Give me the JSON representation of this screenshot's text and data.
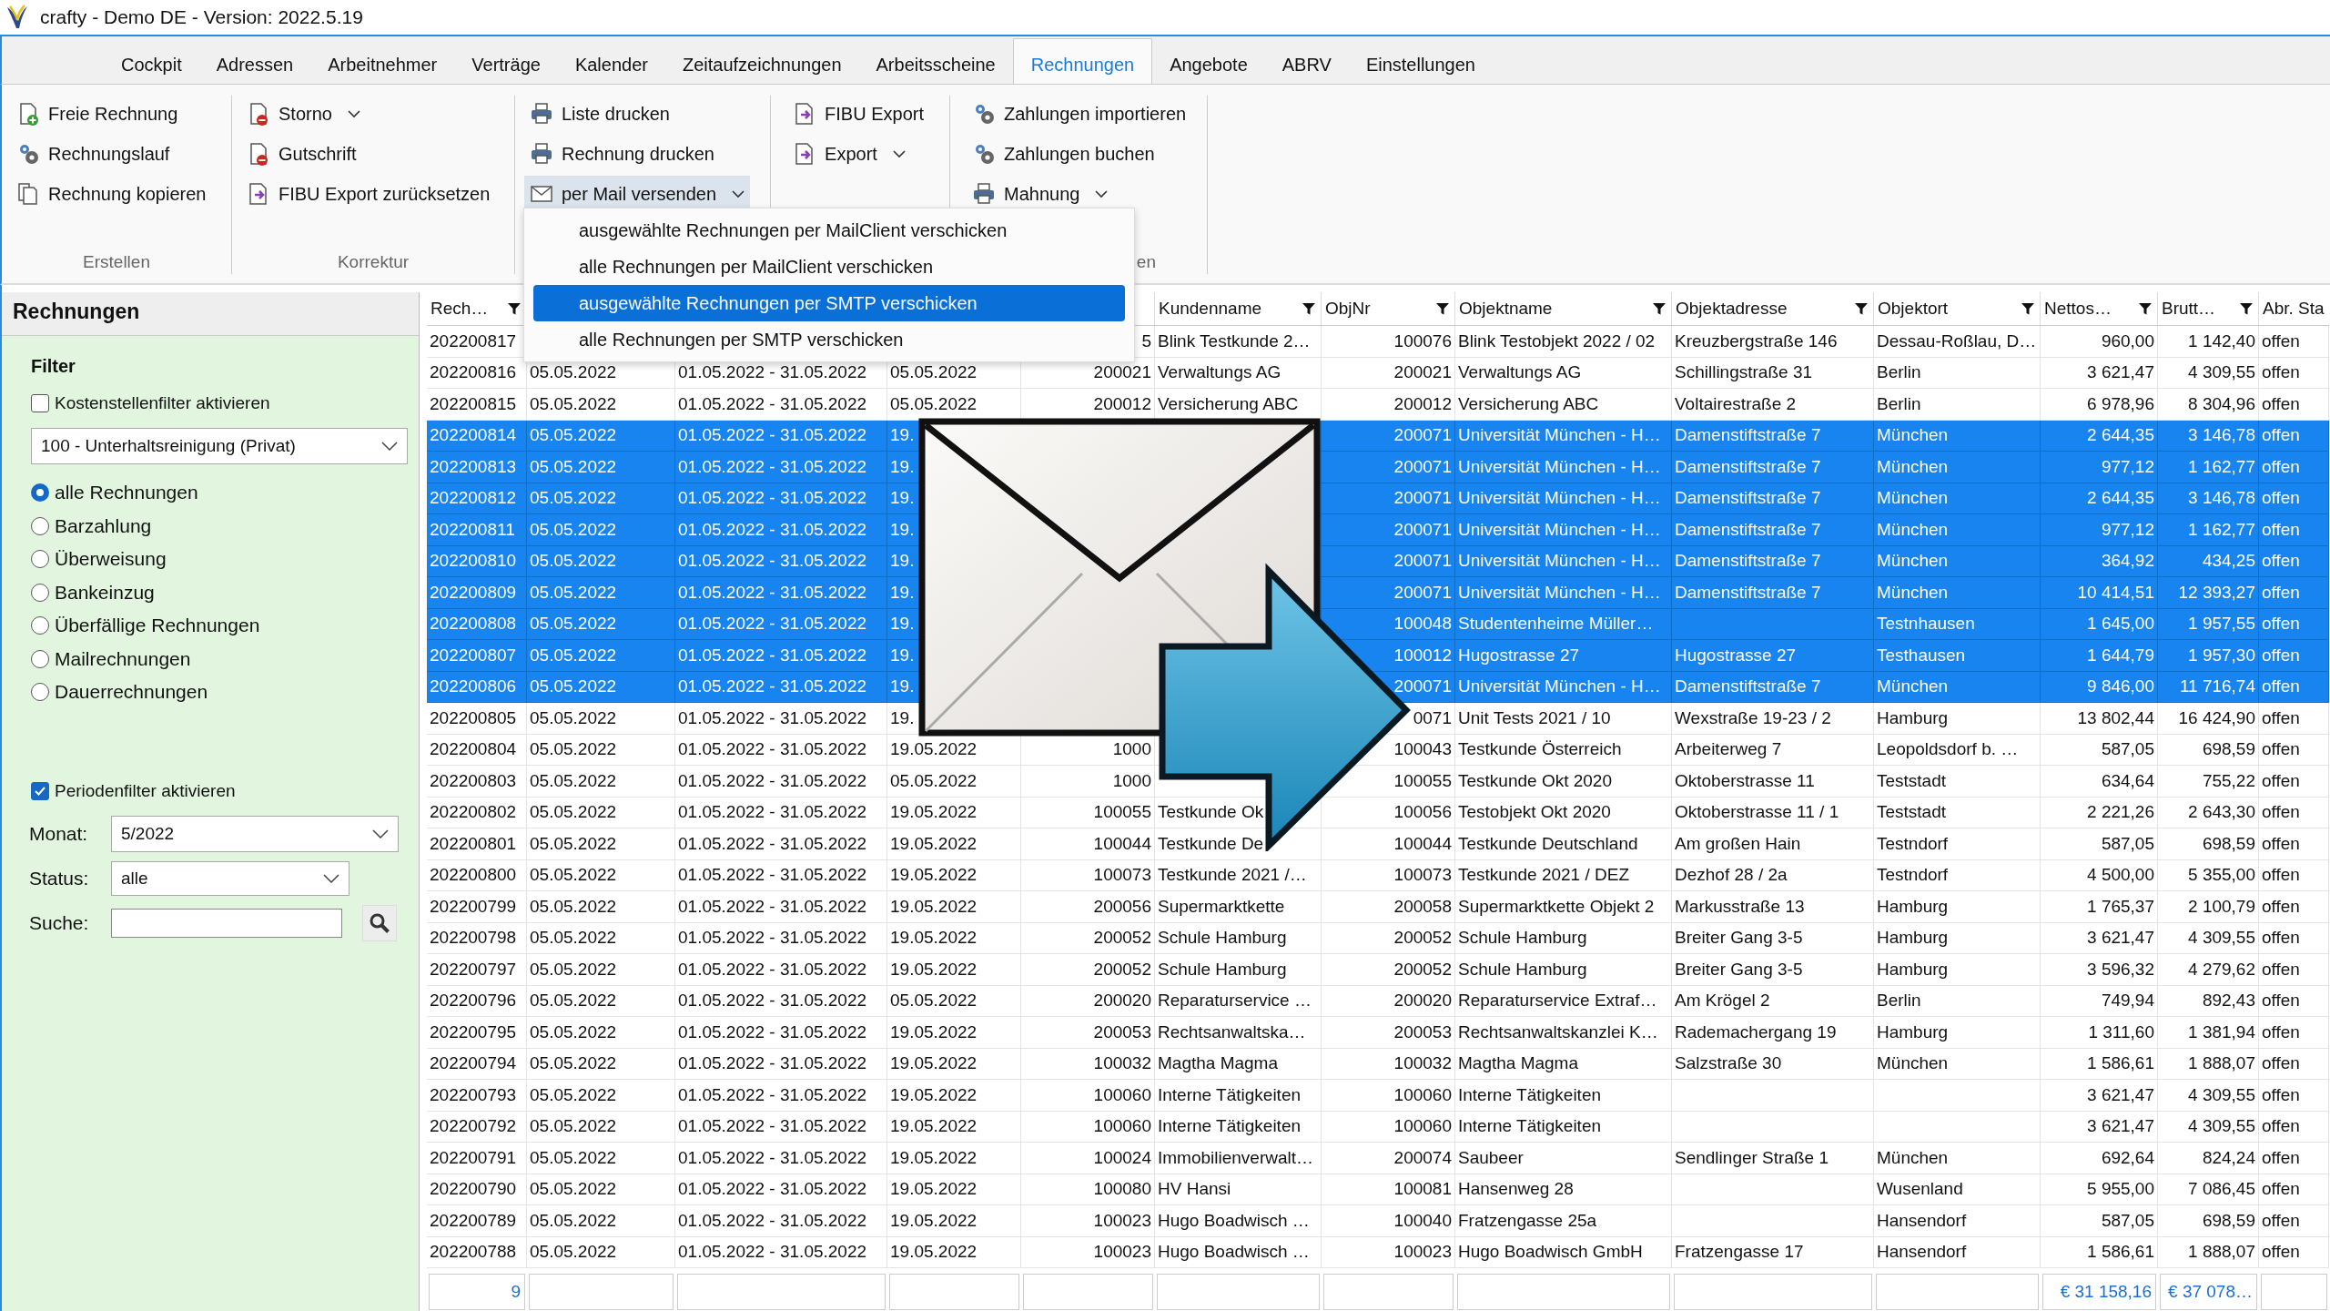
{
  "window": {
    "title": "crafty - Demo DE - Version: 2022.5.19"
  },
  "tabs": [
    {
      "label": "Cockpit",
      "selected": false
    },
    {
      "label": "Adressen",
      "selected": false
    },
    {
      "label": "Arbeitnehmer",
      "selected": false
    },
    {
      "label": "Verträge",
      "selected": false
    },
    {
      "label": "Kalender",
      "selected": false
    },
    {
      "label": "Zeitaufzeichnungen",
      "selected": false
    },
    {
      "label": "Arbeitsscheine",
      "selected": false
    },
    {
      "label": "Rechnungen",
      "selected": true
    },
    {
      "label": "Angebote",
      "selected": false
    },
    {
      "label": "ABRV",
      "selected": false
    },
    {
      "label": "Einstellungen",
      "selected": false
    }
  ],
  "ribbon": {
    "groups": [
      {
        "label": "Erstellen",
        "columns": [
          [
            {
              "label": "Freie Rechnung",
              "kind": "new",
              "dropdown": false,
              "pressed": false
            },
            {
              "label": "Rechnungslauf",
              "kind": "gears",
              "dropdown": false,
              "pressed": false
            },
            {
              "label": "Rechnung kopieren",
              "kind": "copy",
              "dropdown": false,
              "pressed": false
            }
          ]
        ]
      },
      {
        "label": "Korrektur",
        "columns": [
          [
            {
              "label": "Storno",
              "kind": "cancel",
              "dropdown": true,
              "pressed": false
            },
            {
              "label": "Gutschrift",
              "kind": "cancel",
              "dropdown": false,
              "pressed": false
            },
            {
              "label": "FIBU Export zurücksetzen",
              "kind": "export",
              "dropdown": false,
              "pressed": false
            }
          ]
        ]
      },
      {
        "label": "en",
        "columns": [
          [
            {
              "label": "Liste drucken",
              "kind": "print",
              "dropdown": false,
              "pressed": false
            },
            {
              "label": "Rechnung drucken",
              "kind": "print",
              "dropdown": false,
              "pressed": false
            },
            {
              "label": "per Mail versenden",
              "kind": "mail",
              "dropdown": true,
              "pressed": true
            }
          ],
          [
            {
              "label": "FIBU Export",
              "kind": "export",
              "dropdown": false,
              "pressed": false
            },
            {
              "label": "Export",
              "kind": "export",
              "dropdown": true,
              "pressed": false
            }
          ],
          [
            {
              "label": "Zahlungen importieren",
              "kind": "gears",
              "dropdown": false,
              "pressed": false
            },
            {
              "label": "Zahlungen buchen",
              "kind": "gears",
              "dropdown": false,
              "pressed": false
            },
            {
              "label": "Mahnung",
              "kind": "print",
              "dropdown": true,
              "pressed": false
            }
          ]
        ]
      }
    ]
  },
  "mail_menu": [
    {
      "label": "ausgewählte Rechnungen per MailClient verschicken",
      "selected": false
    },
    {
      "label": "alle Rechnungen per MailClient verschicken",
      "selected": false
    },
    {
      "label": "ausgewählte Rechnungen per SMTP verschicken",
      "selected": true
    },
    {
      "label": "alle Rechnungen per SMTP verschicken",
      "selected": false
    }
  ],
  "sidebar": {
    "title": "Rechnungen",
    "filter_heading": "Filter",
    "cost_filter": {
      "label": "Kostenstellenfilter aktivieren",
      "checked": false
    },
    "cost_center": {
      "value": "100 - Unterhaltsreinigung (Privat)"
    },
    "invoice_types": [
      {
        "label": "alle Rechnungen",
        "selected": true
      },
      {
        "label": "Barzahlung",
        "selected": false
      },
      {
        "label": "Überweisung",
        "selected": false
      },
      {
        "label": "Bankeinzug",
        "selected": false
      },
      {
        "label": "Überfällige Rechnungen",
        "selected": false
      },
      {
        "label": "Mailrechnungen",
        "selected": false
      },
      {
        "label": "Dauerrechnungen",
        "selected": false
      }
    ],
    "period_filter": {
      "label": "Periodenfilter aktivieren",
      "checked": true
    },
    "fields": [
      {
        "label": "Monat:",
        "value": "5/2022",
        "kind": "dropdown"
      },
      {
        "label": "Status:",
        "value": "alle",
        "kind": "dropdown"
      },
      {
        "label": "Suche:",
        "kind": "search"
      }
    ]
  },
  "table": {
    "columns": [
      "Rech…",
      null,
      null,
      null,
      null,
      "Kundenname",
      "ObjNr",
      "Objektname",
      "Objektadresse",
      "Objektort",
      "Nettos…",
      "Brutt…",
      "Abr. Sta"
    ],
    "rows": [
      {
        "selected": false,
        "cells": [
          "202200817",
          null,
          null,
          null,
          "5",
          "Blink Testkunde 2…",
          "100076",
          "Blink Testobjekt 2022 / 02",
          "Kreuzbergstraße 146",
          "Dessau-Roßlau, D…",
          "960,00",
          "1 142,40",
          "offen"
        ]
      },
      {
        "selected": false,
        "cells": [
          "202200816",
          "05.05.2022",
          "01.05.2022 - 31.05.2022",
          "05.05.2022",
          "200021",
          "Verwaltungs AG",
          "200021",
          "Verwaltungs AG",
          "Schillingstraße 31",
          "Berlin",
          "3 621,47",
          "4 309,55",
          "offen"
        ]
      },
      {
        "selected": false,
        "cells": [
          "202200815",
          "05.05.2022",
          "01.05.2022 - 31.05.2022",
          "05.05.2022",
          "200012",
          "Versicherung ABC",
          "200012",
          "Versicherung ABC",
          "Voltairestraße 2",
          "Berlin",
          "6 978,96",
          "8 304,96",
          "offen"
        ]
      },
      {
        "selected": true,
        "cells": [
          "202200814",
          "05.05.2022",
          "01.05.2022 - 31.05.2022",
          "19.",
          null,
          null,
          "200071",
          "Universität München - H…",
          "Damenstiftstraße 7",
          "München",
          "2 644,35",
          "3 146,78",
          "offen"
        ]
      },
      {
        "selected": true,
        "cells": [
          "202200813",
          "05.05.2022",
          "01.05.2022 - 31.05.2022",
          "19.",
          null,
          null,
          "200071",
          "Universität München - H…",
          "Damenstiftstraße 7",
          "München",
          "977,12",
          "1 162,77",
          "offen"
        ]
      },
      {
        "selected": true,
        "cells": [
          "202200812",
          "05.05.2022",
          "01.05.2022 - 31.05.2022",
          "19.",
          null,
          null,
          "200071",
          "Universität München - H…",
          "Damenstiftstraße 7",
          "München",
          "2 644,35",
          "3 146,78",
          "offen"
        ]
      },
      {
        "selected": true,
        "cells": [
          "202200811",
          "05.05.2022",
          "01.05.2022 - 31.05.2022",
          "19.",
          null,
          null,
          "200071",
          "Universität München - H…",
          "Damenstiftstraße 7",
          "München",
          "977,12",
          "1 162,77",
          "offen"
        ]
      },
      {
        "selected": true,
        "cells": [
          "202200810",
          "05.05.2022",
          "01.05.2022 - 31.05.2022",
          "19.",
          null,
          null,
          "200071",
          "Universität München - H…",
          "Damenstiftstraße 7",
          "München",
          "364,92",
          "434,25",
          "offen"
        ]
      },
      {
        "selected": true,
        "cells": [
          "202200809",
          "05.05.2022",
          "01.05.2022 - 31.05.2022",
          "19.",
          null,
          null,
          "200071",
          "Universität München - H…",
          "Damenstiftstraße 7",
          "München",
          "10 414,51",
          "12 393,27",
          "offen"
        ]
      },
      {
        "selected": true,
        "cells": [
          "202200808",
          "05.05.2022",
          "01.05.2022 - 31.05.2022",
          "19.",
          null,
          null,
          "100048",
          "Studentenheime Müller…",
          null,
          "Testnhausen",
          "1 645,00",
          "1 957,55",
          "offen"
        ]
      },
      {
        "selected": true,
        "cells": [
          "202200807",
          "05.05.2022",
          "01.05.2022 - 31.05.2022",
          "19.",
          null,
          null,
          "100012",
          "Hugostrasse 27",
          "Hugostrasse 27",
          "Testhausen",
          "1 644,79",
          "1 957,30",
          "offen"
        ]
      },
      {
        "selected": true,
        "cells": [
          "202200806",
          "05.05.2022",
          "01.05.2022 - 31.05.2022",
          "19.",
          null,
          null,
          "200071",
          "Universität München - H…",
          "Damenstiftstraße 7",
          "München",
          "9 846,00",
          "11 716,74",
          "offen"
        ]
      },
      {
        "selected": false,
        "cells": [
          "202200805",
          "05.05.2022",
          "01.05.2022 - 31.05.2022",
          "19.",
          null,
          null,
          "0071",
          "Unit Tests 2021 / 10",
          "Wexstraße 19-23 / 2",
          "Hamburg",
          "13 802,44",
          "16 424,90",
          "offen"
        ]
      },
      {
        "selected": false,
        "cells": [
          "202200804",
          "05.05.2022",
          "01.05.2022 - 31.05.2022",
          "19.05.2022",
          "1000",
          null,
          "100043",
          "Testkunde Österreich",
          "Arbeiterweg 7",
          "Leopoldsdorf b. …",
          "587,05",
          "698,59",
          "offen"
        ]
      },
      {
        "selected": false,
        "cells": [
          "202200803",
          "05.05.2022",
          "01.05.2022 - 31.05.2022",
          "05.05.2022",
          "1000",
          null,
          "100055",
          "Testkunde Okt 2020",
          "Oktoberstrasse 11",
          "Teststadt",
          "634,64",
          "755,22",
          "offen"
        ]
      },
      {
        "selected": false,
        "cells": [
          "202200802",
          "05.05.2022",
          "01.05.2022 - 31.05.2022",
          "19.05.2022",
          "100055",
          "Testkunde Ok",
          "100056",
          "Testobjekt Okt 2020",
          "Oktoberstrasse 11 / 1",
          "Teststadt",
          "2 221,26",
          "2 643,30",
          "offen"
        ]
      },
      {
        "selected": false,
        "cells": [
          "202200801",
          "05.05.2022",
          "01.05.2022 - 31.05.2022",
          "19.05.2022",
          "100044",
          "Testkunde De",
          "100044",
          "Testkunde Deutschland",
          "Am großen Hain",
          "Testndorf",
          "587,05",
          "698,59",
          "offen"
        ]
      },
      {
        "selected": false,
        "cells": [
          "202200800",
          "05.05.2022",
          "01.05.2022 - 31.05.2022",
          "19.05.2022",
          "100073",
          "Testkunde 2021 /…",
          "100073",
          "Testkunde 2021 / DEZ",
          "Dezhof 28 / 2a",
          "Testndorf",
          "4 500,00",
          "5 355,00",
          "offen"
        ]
      },
      {
        "selected": false,
        "cells": [
          "202200799",
          "05.05.2022",
          "01.05.2022 - 31.05.2022",
          "19.05.2022",
          "200056",
          "Supermarktkette",
          "200058",
          "Supermarktkette Objekt 2",
          "Markusstraße 13",
          "Hamburg",
          "1 765,37",
          "2 100,79",
          "offen"
        ]
      },
      {
        "selected": false,
        "cells": [
          "202200798",
          "05.05.2022",
          "01.05.2022 - 31.05.2022",
          "19.05.2022",
          "200052",
          "Schule Hamburg",
          "200052",
          "Schule Hamburg",
          "Breiter Gang 3-5",
          "Hamburg",
          "3 621,47",
          "4 309,55",
          "offen"
        ]
      },
      {
        "selected": false,
        "cells": [
          "202200797",
          "05.05.2022",
          "01.05.2022 - 31.05.2022",
          "19.05.2022",
          "200052",
          "Schule Hamburg",
          "200052",
          "Schule Hamburg",
          "Breiter Gang 3-5",
          "Hamburg",
          "3 596,32",
          "4 279,62",
          "offen"
        ]
      },
      {
        "selected": false,
        "cells": [
          "202200796",
          "05.05.2022",
          "01.05.2022 - 31.05.2022",
          "05.05.2022",
          "200020",
          "Reparaturservice …",
          "200020",
          "Reparaturservice Extraf…",
          "Am Krögel 2",
          "Berlin",
          "749,94",
          "892,43",
          "offen"
        ]
      },
      {
        "selected": false,
        "cells": [
          "202200795",
          "05.05.2022",
          "01.05.2022 - 31.05.2022",
          "19.05.2022",
          "200053",
          "Rechtsanwaltska…",
          "200053",
          "Rechtsanwaltskanzlei K…",
          "Rademachergang 19",
          "Hamburg",
          "1 311,60",
          "1 381,94",
          "offen"
        ]
      },
      {
        "selected": false,
        "cells": [
          "202200794",
          "05.05.2022",
          "01.05.2022 - 31.05.2022",
          "19.05.2022",
          "100032",
          "Magtha Magma",
          "100032",
          "Magtha Magma",
          "Salzstraße 30",
          "München",
          "1 586,61",
          "1 888,07",
          "offen"
        ]
      },
      {
        "selected": false,
        "cells": [
          "202200793",
          "05.05.2022",
          "01.05.2022 - 31.05.2022",
          "19.05.2022",
          "100060",
          "Interne Tätigkeiten",
          "100060",
          "Interne Tätigkeiten",
          null,
          null,
          "3 621,47",
          "4 309,55",
          "offen"
        ]
      },
      {
        "selected": false,
        "cells": [
          "202200792",
          "05.05.2022",
          "01.05.2022 - 31.05.2022",
          "19.05.2022",
          "100060",
          "Interne Tätigkeiten",
          "100060",
          "Interne Tätigkeiten",
          null,
          null,
          "3 621,47",
          "4 309,55",
          "offen"
        ]
      },
      {
        "selected": false,
        "cells": [
          "202200791",
          "05.05.2022",
          "01.05.2022 - 31.05.2022",
          "19.05.2022",
          "100024",
          "Immobilienverwalt…",
          "200074",
          "Saubeer",
          "Sendlinger Straße 1",
          "München",
          "692,64",
          "824,24",
          "offen"
        ]
      },
      {
        "selected": false,
        "cells": [
          "202200790",
          "05.05.2022",
          "01.05.2022 - 31.05.2022",
          "19.05.2022",
          "100080",
          "HV Hansi",
          "100081",
          "Hansenweg 28",
          null,
          "Wusenland",
          "5 955,00",
          "7 086,45",
          "offen"
        ]
      },
      {
        "selected": false,
        "cells": [
          "202200789",
          "05.05.2022",
          "01.05.2022 - 31.05.2022",
          "19.05.2022",
          "100023",
          "Hugo Boadwisch …",
          "100040",
          "Fratzengasse 25a",
          null,
          "Hansendorf",
          "587,05",
          "698,59",
          "offen"
        ]
      },
      {
        "selected": false,
        "cells": [
          "202200788",
          "05.05.2022",
          "01.05.2022 - 31.05.2022",
          "19.05.2022",
          "100023",
          "Hugo Boadwisch …",
          "100023",
          "Hugo Boadwisch GmbH",
          "Fratzengasse 17",
          "Hansendorf",
          "1 586,61",
          "1 888,07",
          "offen"
        ]
      }
    ],
    "totals": {
      "count": "9",
      "net": "€ 31 158,16",
      "gross": "€ 37 078…"
    }
  }
}
